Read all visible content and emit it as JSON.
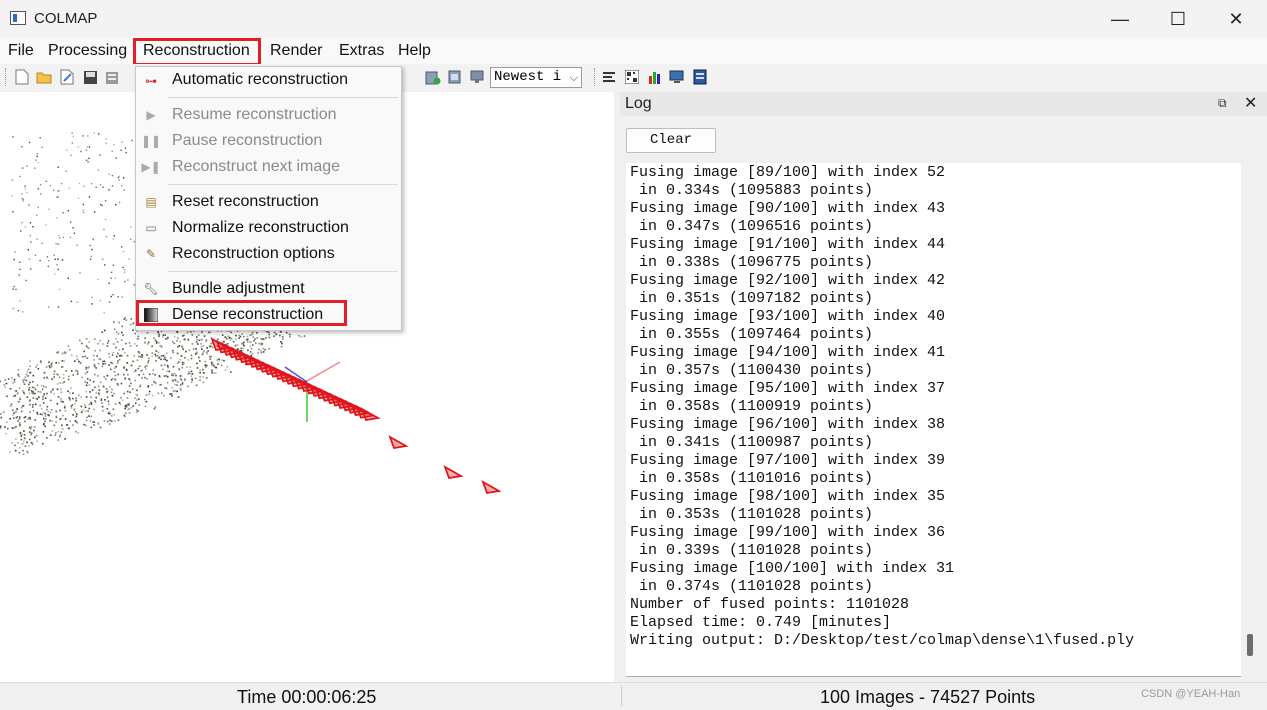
{
  "window": {
    "title": "COLMAP",
    "minimize_glyph": "—",
    "maximize_glyph": "☐",
    "close_glyph": "✕"
  },
  "menubar": {
    "items": [
      "File",
      "Processing",
      "Reconstruction",
      "Render",
      "Extras",
      "Help"
    ]
  },
  "toolbar": {
    "combo_value": "Newest i",
    "left_icons": [
      "new-project-icon",
      "open-project-icon",
      "edit-project-icon",
      "save-project-icon",
      "import-icon"
    ],
    "mid_icons": [
      "grab-image-icon",
      "grab-movie-icon",
      "undistort-icon"
    ],
    "right_icons": [
      "log-icon",
      "match-matrix-icon",
      "histogram-icon",
      "monitor-icon",
      "database-icon"
    ]
  },
  "reconstruction_menu": {
    "items": [
      {
        "label": "Automatic reconstruction",
        "icon": "automatic-reconstruction-icon",
        "enabled": true
      },
      {
        "label": "Resume reconstruction",
        "icon": "play-icon",
        "enabled": false
      },
      {
        "label": "Pause reconstruction",
        "icon": "pause-icon",
        "enabled": false
      },
      {
        "label": "Reconstruct next image",
        "icon": "step-icon",
        "enabled": false
      },
      {
        "label": "Reset reconstruction",
        "icon": "reset-icon",
        "enabled": true
      },
      {
        "label": "Normalize reconstruction",
        "icon": "normalize-icon",
        "enabled": true
      },
      {
        "label": "Reconstruction options",
        "icon": "options-icon",
        "enabled": true
      },
      {
        "label": "Bundle adjustment",
        "icon": "wrench-icon",
        "enabled": true
      },
      {
        "label": "Dense reconstruction",
        "icon": "dense-icon",
        "enabled": true
      }
    ]
  },
  "log": {
    "title": "Log",
    "clear_label": "Clear",
    "lines": [
      "Fusing image [89/100] with index 52",
      " in 0.334s (1095883 points)",
      "Fusing image [90/100] with index 43",
      " in 0.347s (1096516 points)",
      "Fusing image [91/100] with index 44",
      " in 0.338s (1096775 points)",
      "Fusing image [92/100] with index 42",
      " in 0.351s (1097182 points)",
      "Fusing image [93/100] with index 40",
      " in 0.355s (1097464 points)",
      "Fusing image [94/100] with index 41",
      " in 0.357s (1100430 points)",
      "Fusing image [95/100] with index 37",
      " in 0.358s (1100919 points)",
      "Fusing image [96/100] with index 38",
      " in 0.341s (1100987 points)",
      "Fusing image [97/100] with index 39",
      " in 0.358s (1101016 points)",
      "Fusing image [98/100] with index 35",
      " in 0.353s (1101028 points)",
      "Fusing image [99/100] with index 36",
      " in 0.339s (1101028 points)",
      "Fusing image [100/100] with index 31",
      " in 0.374s (1101028 points)",
      "Number of fused points: 1101028",
      "Elapsed time: 0.749 [minutes]",
      "Writing output: D:/Desktop/test/colmap\\dense\\1\\fused.ply"
    ]
  },
  "statusbar": {
    "time": "Time 00:00:06:25",
    "counts": "100 Images - 74527 Points"
  },
  "watermark": "CSDN @YEAH-Han",
  "colors": {
    "highlight": "#e21e26",
    "camera": "#e0161c"
  }
}
